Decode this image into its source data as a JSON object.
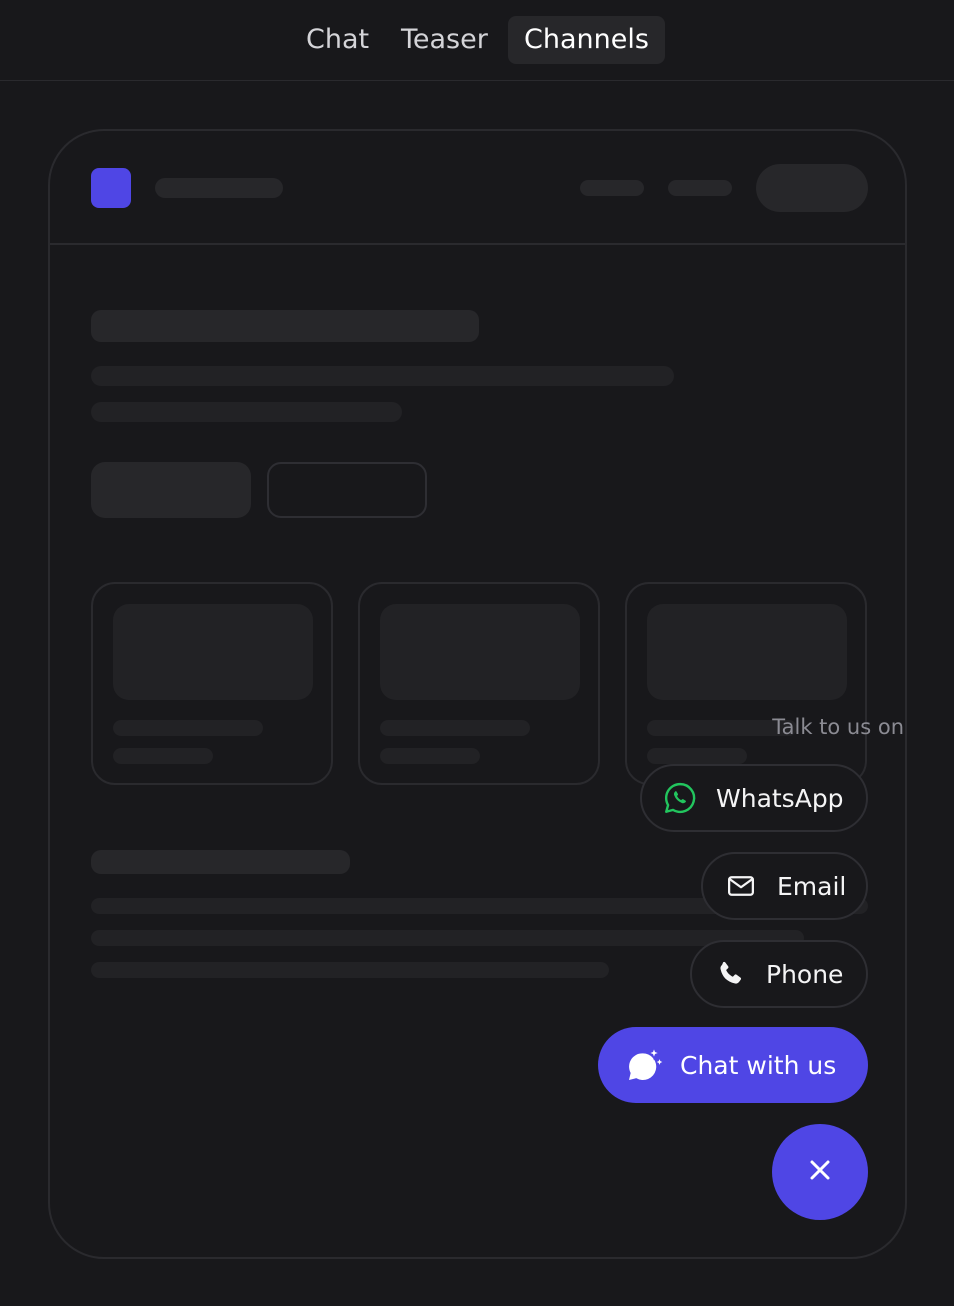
{
  "tabs": [
    {
      "label": "Chat"
    },
    {
      "label": "Teaser"
    },
    {
      "label": "Channels"
    }
  ],
  "active_tab": "Channels",
  "widget": {
    "heading": "Talk to us on",
    "channels": [
      {
        "label": "WhatsApp",
        "icon": "whatsapp-icon"
      },
      {
        "label": "Email",
        "icon": "mail-icon"
      },
      {
        "label": "Phone",
        "icon": "phone-icon"
      }
    ],
    "chat_label": "Chat with us",
    "chat_icon": "chat-sparkle-icon",
    "close_icon": "close-icon"
  },
  "colors": {
    "accent": "#4f46e5",
    "whatsapp": "#22c55e",
    "background": "#18181b",
    "skeleton": "#27272a"
  }
}
